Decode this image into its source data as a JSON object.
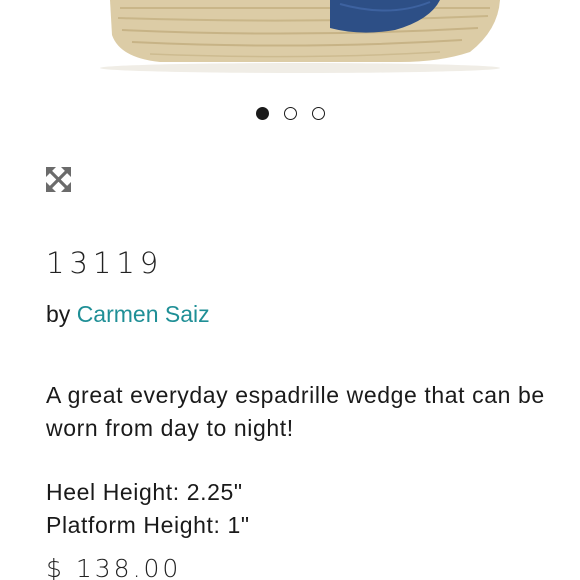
{
  "carousel": {
    "slide_count": 3,
    "active_index": 0
  },
  "product": {
    "title": "13119",
    "by_prefix": "by",
    "brand": "Carmen Saiz",
    "description": "A great everyday espadrille wedge that can be worn from day to night!",
    "heel_height": "Heel Height: 2.25\"",
    "platform_height": "Platform Height: 1\"",
    "price": "$ 138.00"
  },
  "colors": {
    "brand_link": "#1f8f96",
    "shoe_blue": "#2d4f86",
    "jute": "#d9c9a3"
  },
  "icons": {
    "expand": "expand-arrows-icon"
  }
}
